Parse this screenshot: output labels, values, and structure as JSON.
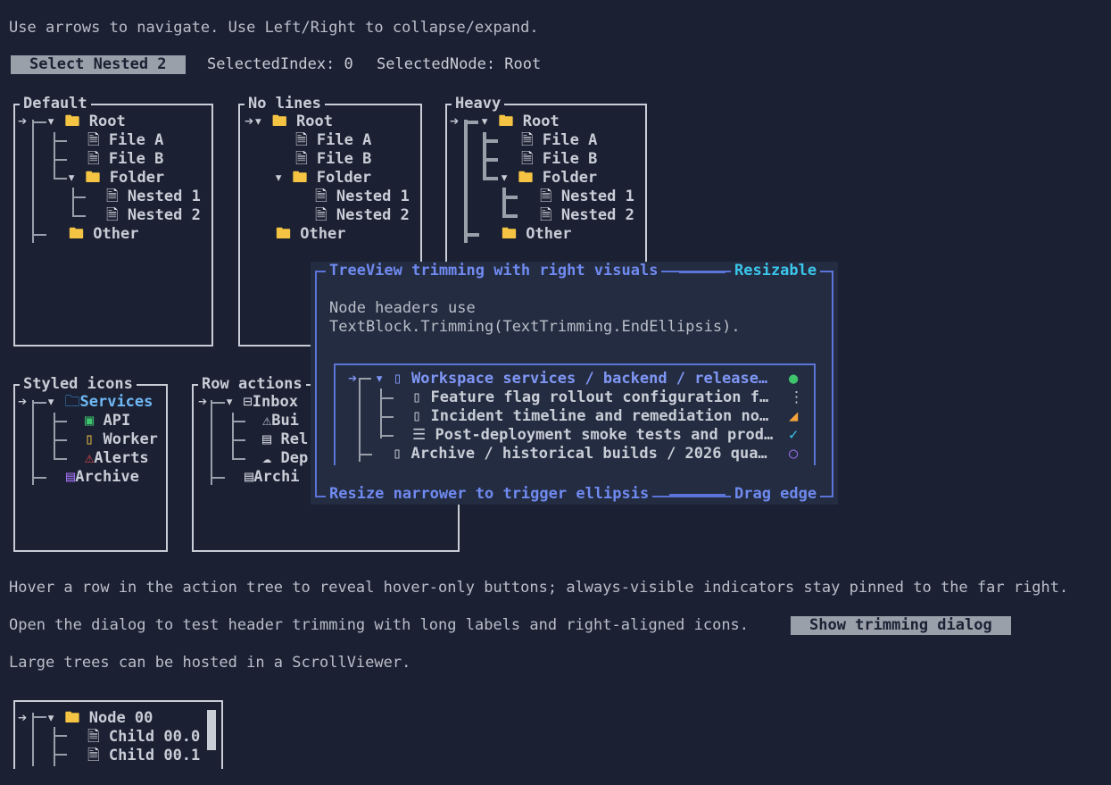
{
  "instructions": "Use arrows to navigate. Use Left/Right to collapse/expand.",
  "select_button": "Select Nested 2",
  "selected_index": "SelectedIndex: 0",
  "selected_node": "SelectedNode: Root",
  "panels": {
    "default": {
      "title": "Default"
    },
    "no_lines": {
      "title": "No lines"
    },
    "heavy": {
      "title": "Heavy"
    },
    "styled_icons": {
      "title": "Styled icons"
    },
    "row_actions": {
      "title": "Row actions"
    }
  },
  "basic_tree": {
    "root": "Root",
    "file_a": "File A",
    "file_b": "File B",
    "folder": "Folder",
    "nested1": "Nested 1",
    "nested2": "Nested 2",
    "other": "Other"
  },
  "styled_tree": {
    "services": "Services",
    "api": "API",
    "worker": "Worker",
    "alerts": "Alerts",
    "archive": "Archive"
  },
  "actions_tree": {
    "inbox": "Inbox",
    "builds": "Bui",
    "releases": "Rel",
    "deploy": "Dep",
    "archive": "Archi"
  },
  "dialog": {
    "title": "TreeView trimming with right visuals",
    "title_right": "Resizable",
    "desc1": "Node headers use",
    "desc2": "TextBlock.Trimming(TextTrimming.EndEllipsis).",
    "rows": [
      "Workspace services / backend / release…",
      "Feature flag rollout configuration f…",
      "Incident timeline and remediation no…",
      "Post-deployment smoke tests and prod…",
      "Archive / historical builds / 2026 qua…"
    ],
    "footer": "Resize narrower to trigger ellipsis",
    "footer_right": "Drag edge"
  },
  "hover_hint": "Hover a row in the action tree to reveal hover-only buttons; always-visible indicators stay pinned to the far right.",
  "dialog_hint": "Open the dialog to test header trimming with long labels and right-aligned icons.",
  "show_dialog_button": "Show trimming dialog",
  "scroll_hint": "Large trees can be hosted in a ScrollViewer.",
  "scroll_tree": {
    "node": "Node 00",
    "child0": "Child 00.0",
    "child1": "Child 00.1"
  },
  "colors": {
    "background": "#1b2133",
    "accent": "#6f8af0",
    "folder": "#f6c443",
    "dialog_bg": "#242c41"
  }
}
